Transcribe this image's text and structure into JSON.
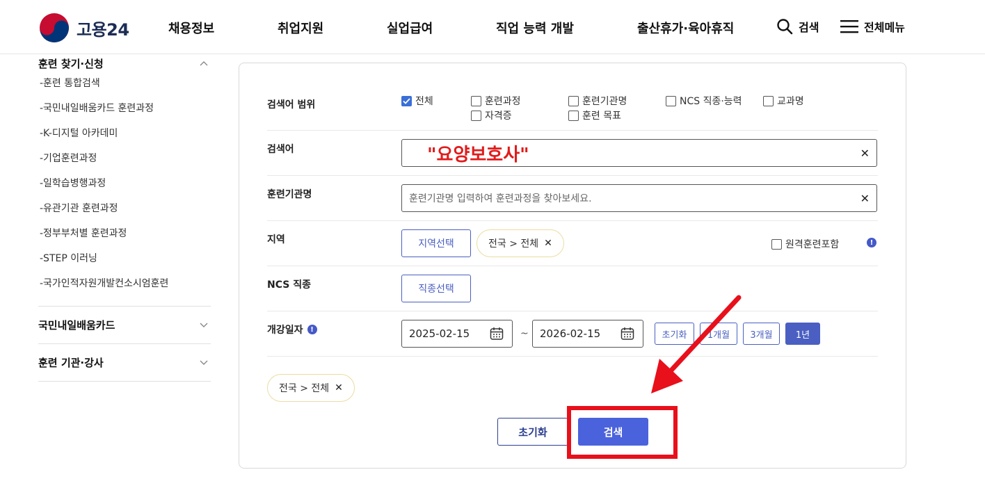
{
  "header": {
    "logo_text": "고용24",
    "nav": [
      "채용정보",
      "취업지원",
      "실업급여",
      "직업 능력 개발",
      "출산휴가·육아휴직"
    ],
    "search_label": "검색",
    "menu_label": "전체메뉴"
  },
  "sidebar": {
    "section1_title": "훈련 찾기·신청",
    "items": [
      "-훈련 통합검색",
      "-국민내일배움카드 훈련과정",
      "-K-디지털 아카데미",
      "-기업훈련과정",
      "-일학습병행과정",
      "-유관기관 훈련과정",
      "-정부부처별 훈련과정",
      "-STEP 이러닝",
      "-국가인적자원개발컨소시엄훈련"
    ],
    "section2_title": "국민내일배움카드",
    "section3_title": "훈련 기관·강사"
  },
  "form": {
    "scope_label": "검색어 범위",
    "scope_options": [
      {
        "label": "전체",
        "checked": true
      },
      {
        "label": "훈련과정",
        "checked": false
      },
      {
        "label": "훈련기관명",
        "checked": false
      },
      {
        "label": "NCS 직종·능력",
        "checked": false
      },
      {
        "label": "교과명",
        "checked": false
      },
      {
        "label": "자격증",
        "checked": false
      },
      {
        "label": "훈련 목표",
        "checked": false
      }
    ],
    "keyword_label": "검색어",
    "keyword_value": "\"요양보호사\"",
    "institution_label": "훈련기관명",
    "institution_placeholder": "훈련기관명 입력하여 훈련과정을 찾아보세요.",
    "region_label": "지역",
    "region_button": "지역선택",
    "region_tag": "전국 > 전체",
    "remote_label": "원격훈련포함",
    "ncs_label": "NCS 직종",
    "ncs_button": "직종선택",
    "date_label": "개강일자",
    "date_from": "2025-02-15",
    "date_to": "2026-02-15",
    "tilde": "~",
    "period_buttons": [
      "초기화",
      "1개월",
      "3개월",
      "1년"
    ],
    "active_period": "1년",
    "selected_tag": "전국 > 전체",
    "reset_button": "초기화",
    "search_button": "검색"
  },
  "colors": {
    "accent": "#4a62dc",
    "annotation": "#e8101b",
    "keyword": "#e21b1b"
  },
  "icons": {
    "close": "✕",
    "check": "✓",
    "info": "!"
  }
}
